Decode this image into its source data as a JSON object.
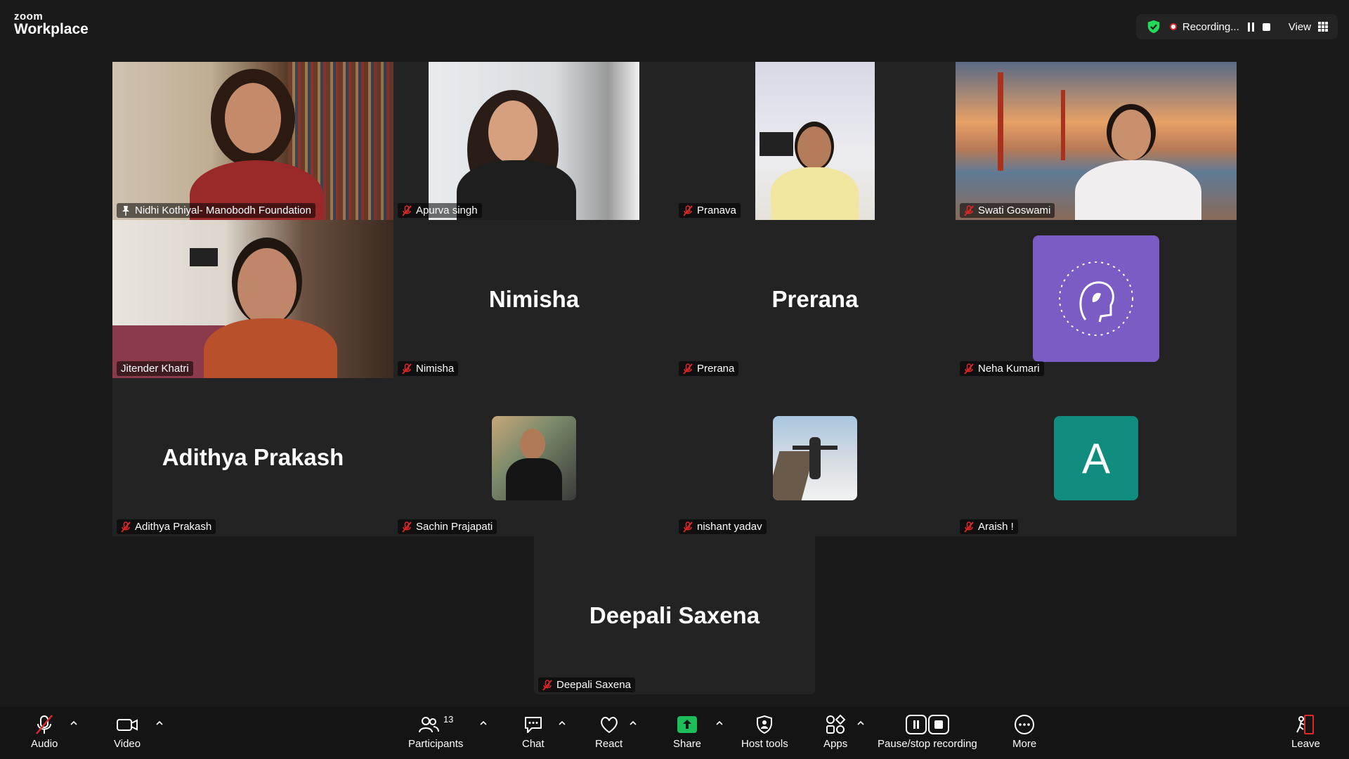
{
  "app": {
    "logo_top": "zoom",
    "logo_bottom": "Workplace"
  },
  "topbar": {
    "recording_label": "Recording...",
    "view_label": "View"
  },
  "participants": [
    {
      "name": "Nidhi Kothiyal- Manobodh Foundation",
      "display": "video",
      "pinned": true,
      "active_speaker": true
    },
    {
      "name": "Apurva singh",
      "display": "video",
      "muted": true
    },
    {
      "name": "Pranava",
      "display": "video",
      "muted": true
    },
    {
      "name": "Swati Goswami",
      "display": "video",
      "muted": true
    },
    {
      "name": "Jitender Khatri",
      "display": "video",
      "muted": false
    },
    {
      "name": "Nimisha",
      "display": "name",
      "big_name": "Nimisha",
      "muted": true
    },
    {
      "name": "Prerana",
      "display": "name",
      "big_name": "Prerana",
      "muted": true
    },
    {
      "name": "Neha Kumari",
      "display": "avatar-logo",
      "muted": true
    },
    {
      "name": "Adithya Prakash",
      "display": "name",
      "big_name": "Adithya Prakash",
      "muted": true
    },
    {
      "name": "Sachin Prajapati",
      "display": "avatar-photo",
      "muted": true
    },
    {
      "name": "nishant yadav",
      "display": "avatar-photo",
      "muted": true
    },
    {
      "name": "Araish !",
      "display": "avatar-letter",
      "avatar_letter": "A",
      "avatar_color": "#118d80",
      "muted": true
    },
    {
      "name": "Deepali Saxena",
      "display": "name",
      "big_name": "Deepali Saxena",
      "muted": true
    }
  ],
  "toolbar": {
    "audio": "Audio",
    "video": "Video",
    "participants": "Participants",
    "participants_count": "13",
    "chat": "Chat",
    "react": "React",
    "share": "Share",
    "host_tools": "Host tools",
    "apps": "Apps",
    "pause_stop": "Pause/stop recording",
    "more": "More",
    "leave": "Leave"
  },
  "colors": {
    "active_speaker": "#23d959",
    "share_green": "#1dbd5a",
    "leave_red": "#e02828",
    "mute_red": "#e02828"
  }
}
